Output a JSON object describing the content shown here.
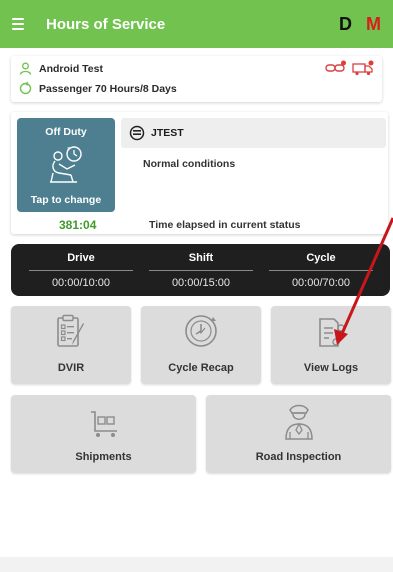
{
  "appbar": {
    "title": "Hours of Service",
    "badge_d": "D",
    "badge_m": "M"
  },
  "profile": {
    "driver_name": "Android Test",
    "cycle_rule": "Passenger 70 Hours/8 Days"
  },
  "status": {
    "duty_status": "Off Duty",
    "tap_hint": "Tap to change",
    "location": "JTEST",
    "conditions": "Normal conditions",
    "elapsed_time": "381:04",
    "elapsed_label": "Time elapsed in current status"
  },
  "hours": [
    {
      "label": "Drive",
      "value": "00:00/10:00"
    },
    {
      "label": "Shift",
      "value": "00:00/15:00"
    },
    {
      "label": "Cycle",
      "value": "00:00/70:00"
    }
  ],
  "tiles": {
    "dvir": {
      "label": "DVIR",
      "icon": "clipboard-checklist-icon"
    },
    "cycle_recap": {
      "label": "Cycle Recap",
      "icon": "clock-cycle-icon"
    },
    "view_logs": {
      "label": "View Logs",
      "icon": "logs-document-icon"
    },
    "shipments": {
      "label": "Shipments",
      "icon": "cart-boxes-icon"
    },
    "road_inspection": {
      "label": "Road Inspection",
      "icon": "officer-icon"
    }
  },
  "colors": {
    "appbar": "#71c24f",
    "duty_tile": "#4d7f91",
    "elapsed": "#3f9b2a",
    "badge_m": "#d6201c",
    "annotation_arrow": "#c8171b"
  }
}
